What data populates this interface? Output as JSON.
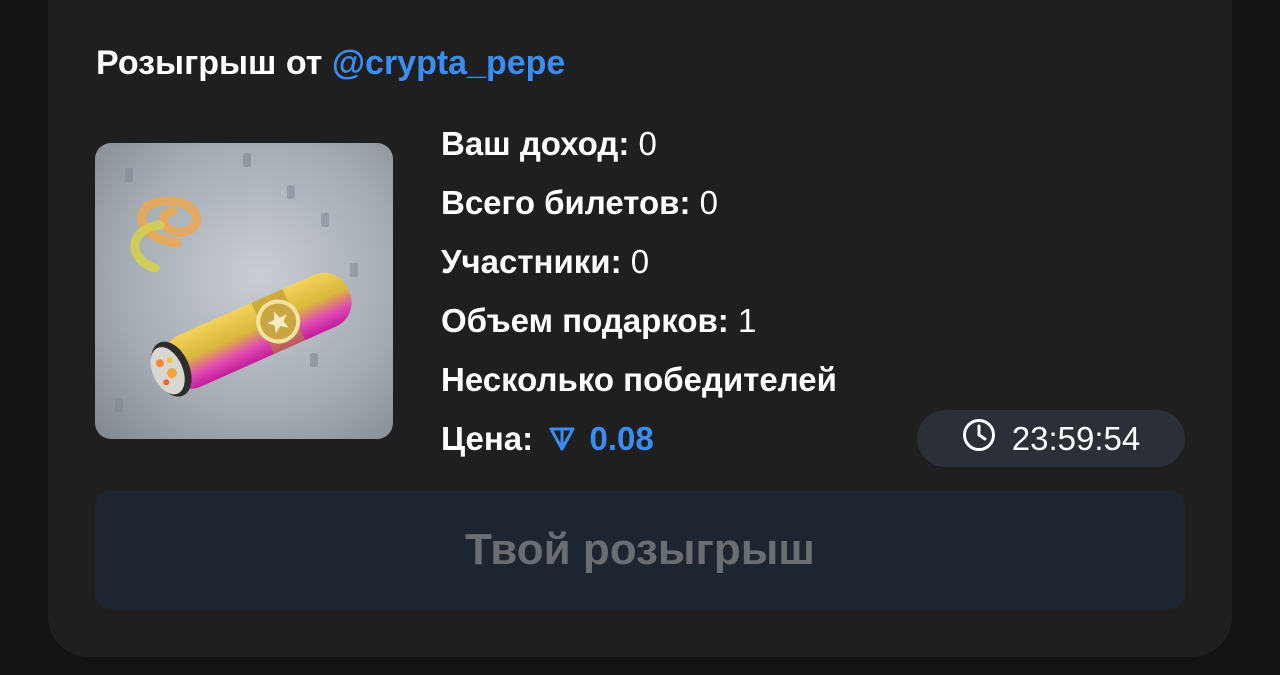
{
  "giveaway": {
    "title_prefix": "Розыгрыш от",
    "creator_handle": "@crypta_pepe",
    "gift_image": "cigar-gift-image",
    "stats": [
      {
        "label": "Ваш доход:",
        "value": "0"
      },
      {
        "label": "Всего билетов:",
        "value": "0"
      },
      {
        "label": "Участники:",
        "value": "0"
      },
      {
        "label": "Объем подарков:",
        "value": "1"
      }
    ],
    "mode_text": "Несколько победителей",
    "price_label": "Цена:",
    "price_currency_icon": "ton-icon",
    "price_value": "0.08",
    "timer_icon": "clock-icon",
    "timer_value": "23:59:54",
    "action_button_label": "Твой розыгрыш"
  },
  "colors": {
    "background": "#131313",
    "card": "#1f1f20",
    "accent": "#3a8ef2",
    "button_bg": "#1d2530",
    "button_text": "#6a6d72",
    "timer_bg": "#2a2f38"
  }
}
